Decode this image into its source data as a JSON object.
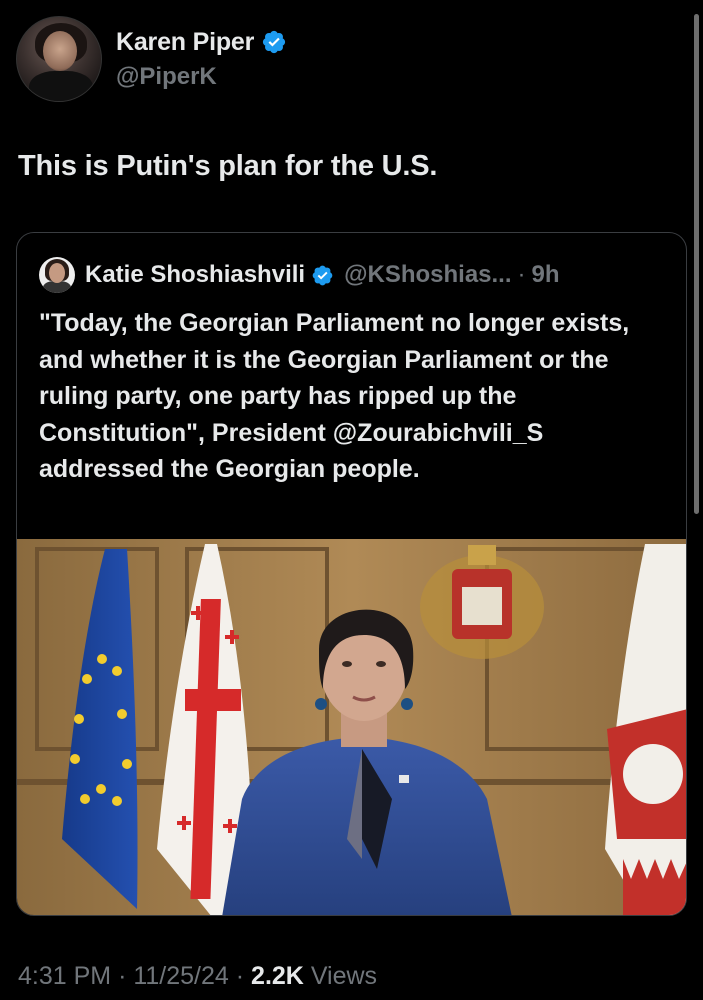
{
  "author": {
    "display_name": "Karen Piper",
    "handle": "@PiperK",
    "verified": true
  },
  "tweet": {
    "text": "This is Putin's plan for the U.S."
  },
  "quoted_tweet": {
    "display_name": "Katie Shoshiashvili",
    "handle": "@KShoshias...",
    "separator": "·",
    "time_ago": "9h",
    "text": "\"Today, the Georgian Parliament no longer exists, and whether it is the Georgian Parliament or the ruling party, one party has ripped up the Constitution\", President @Zourabichvili_S addressed the Georgian people."
  },
  "footer": {
    "time": "4:31 PM",
    "sep1": "·",
    "date": "11/25/24",
    "sep2": "·",
    "views_count": "2.2K",
    "views_label": "Views"
  },
  "colors": {
    "background": "#000000",
    "text_primary": "#e7e9ea",
    "text_secondary": "#71767b",
    "verified_badge": "#1d9bf0",
    "border": "#3a3d41"
  },
  "icons": [
    "verified-badge-icon"
  ]
}
